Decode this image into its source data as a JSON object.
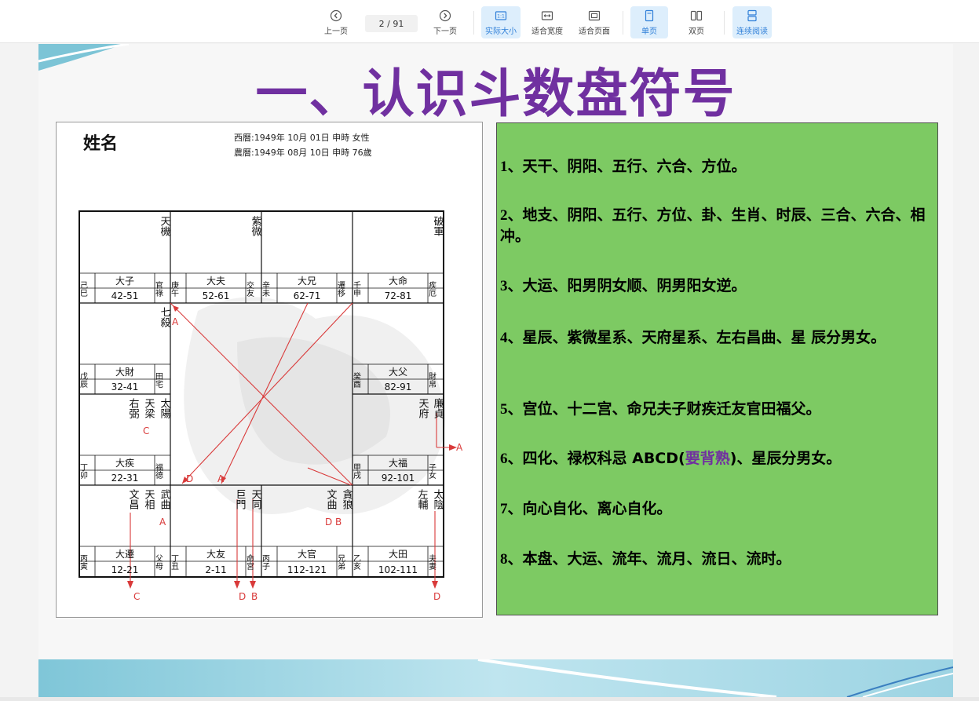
{
  "toolbar": {
    "prev_label": "上一页",
    "next_label": "下一页",
    "current_page": "2",
    "total_pages": "/ 91",
    "actual_size_label": "实际大小",
    "fit_width_label": "适合宽度",
    "fit_page_label": "适合页面",
    "single_page_label": "单页",
    "double_page_label": "双页",
    "continuous_label": "连续阅读",
    "accent_color": "#2f7fd8"
  },
  "slide": {
    "title": "一、认识斗数盘符号",
    "title_color": "#7030a0",
    "chart": {
      "name_label": "姓名",
      "solar_line": "西曆:1949年    10月  01日   申時    女性",
      "lunar_line": "農曆:1949年    08月  10日   申時    76歲",
      "cells": {
        "top1": {
          "stars": "天機",
          "stem": "己巳",
          "limit": "大子",
          "age": "42-51",
          "palace": "官祿"
        },
        "top2": {
          "stars": "紫微",
          "stem": "庚午",
          "limit": "大夫",
          "age": "52-61",
          "palace": "交友"
        },
        "top3": {
          "stars": "",
          "stem": "辛未",
          "limit": "大兄",
          "age": "62-71",
          "palace": "遷移"
        },
        "top4": {
          "stars": "破軍",
          "stem": "壬申",
          "limit": "大命",
          "age": "72-81",
          "palace": "疾厄"
        },
        "left2": {
          "stars": "七殺",
          "stem": "戊辰",
          "limit": "大財",
          "age": "32-41",
          "palace": "田宅"
        },
        "right2": {
          "stars": "",
          "stem": "癸酉",
          "limit": "大父",
          "age": "82-91",
          "palace": "財帛"
        },
        "left3": {
          "stars_a": "右弼",
          "stars_b": "天梁",
          "stars_c": "太陽",
          "mark": "C",
          "stem": "丁卯",
          "limit": "大疾",
          "age": "22-31",
          "palace": "福德"
        },
        "right3": {
          "stars": "天府",
          "stars_b": "廉貞",
          "stem": "甲戌",
          "limit": "大福",
          "age": "92-101",
          "palace": "子女"
        },
        "bot1": {
          "stars_a": "文昌",
          "stars_b": "天相",
          "stars_c": "武曲",
          "mark": "A",
          "stem": "丙寅",
          "limit": "大遷",
          "age": "12-21",
          "palace": "父母"
        },
        "bot2": {
          "stars_a": "巨門",
          "stars_b": "天同",
          "stem": "丁丑",
          "limit": "大友",
          "age": "2-11",
          "palace": "命宮"
        },
        "bot3": {
          "stars_a": "文曲",
          "stars_b": "貪狼",
          "mark": "D  B",
          "stem": "丙子",
          "limit": "大官",
          "age": "112-121",
          "palace": "兄弟"
        },
        "bot4": {
          "stars_a": "左輔",
          "stars_b": "太陰",
          "stem": "乙亥",
          "limit": "大田",
          "age": "102-111",
          "palace": "夫妻"
        }
      },
      "arrow_labels": {
        "a_top": "A",
        "a_right": "A",
        "a_mid": "A",
        "d_mid": "D",
        "c_bottom": "C",
        "d_bottom1": "D",
        "b_bottom": "B",
        "d_bottom2": "D"
      },
      "arrow_color": "#d93a3a"
    },
    "list": [
      {
        "num": "1",
        "text": "、天干、阴阳、五行、六合、方位。"
      },
      {
        "num": "2",
        "text": "、地支、阴阳、五行、方位、卦、生肖、时辰、三合、六合、相冲。"
      },
      {
        "num": "3",
        "text": "、大运、阳男阴女顺、阴男阳女逆。"
      },
      {
        "num": "4",
        "text": "、星辰、紫微星系、天府星系、左右昌曲、星 辰分男女。"
      },
      {
        "num": "5",
        "text": "、宫位、十二宫、命兄夫子财疾迁友官田福父。"
      },
      {
        "num": "6",
        "text_a": "、四化、禄权科忌 ABCD(",
        "highlight": "要背熟",
        "text_b": ")、星辰分男女。"
      },
      {
        "num": "7",
        "text": "、向心自化、离心自化。"
      },
      {
        "num": "8",
        "text": "、本盘、大运、流年、流月、流日、流时。"
      }
    ],
    "panel_color": "#7dca63"
  }
}
